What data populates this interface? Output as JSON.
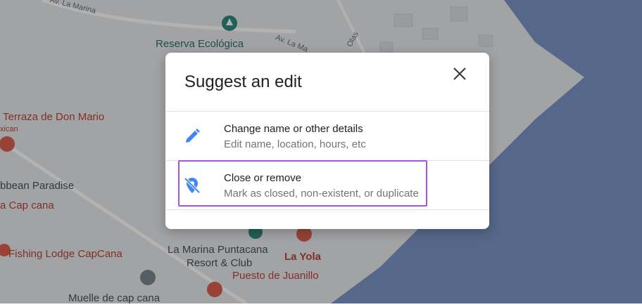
{
  "map": {
    "labels": {
      "road_la_marina": "Av. La Marina",
      "road_la_marina_2": "Av. La Ma",
      "road_olas": "Olas",
      "reserva": "Reserva Ecológica",
      "terraza": "Terraza de Don Mario",
      "mexican": "xican",
      "caribbean": "bbean Paradise",
      "cap_cana": "a Cap cana",
      "fishing_lodge": "Fishing Lodge CapCana",
      "la_marina_resort_1": "La Marina Puntacana",
      "la_marina_resort_2": "Resort & Club",
      "la_yola": "La Yola",
      "puesto": "Puesto de Juanillo",
      "muelle": "Muelle de cap cana"
    }
  },
  "dialog": {
    "title": "Suggest an edit",
    "close_icon": "close-icon",
    "options": [
      {
        "icon": "pencil-icon",
        "title": "Change name or other details",
        "subtitle": "Edit name, location, hours, etc"
      },
      {
        "icon": "location-off-icon",
        "title": "Close or remove",
        "subtitle": "Mark as closed, non-existent, or duplicate"
      }
    ]
  },
  "colors": {
    "land": "#e8eaed",
    "water": "#7b95c6",
    "accent_blue": "#4285f4",
    "highlight_purple": "#a855d6"
  }
}
